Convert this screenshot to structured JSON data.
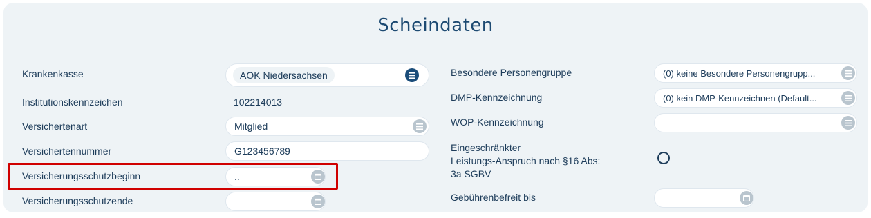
{
  "title": "Scheindaten",
  "left": {
    "krankenkasse": {
      "label": "Krankenkasse",
      "value": "AOK Niedersachsen",
      "icon": "list-icon"
    },
    "institutionskennzeichen": {
      "label": "Institutionskennzeichen",
      "value": "102214013"
    },
    "versichertenart": {
      "label": "Versichertenart",
      "value": "Mitglied",
      "icon": "list-icon"
    },
    "versichertennummer": {
      "label": "Versichertennummer",
      "value": "G123456789"
    },
    "schutzbeginn": {
      "label": "Versicherungsschutzbeginn",
      "value": "..",
      "icon": "calendar-icon"
    },
    "schutzende": {
      "label": "Versicherungsschutzende",
      "value": "",
      "icon": "calendar-icon"
    }
  },
  "right": {
    "personengruppe": {
      "label": "Besondere Personengruppe",
      "value": "(0) keine Besondere Personengrupp...",
      "icon": "list-icon"
    },
    "dmp": {
      "label": "DMP-Kennzeichnung",
      "value": "(0) kein DMP-Kennzeichnen (Default...",
      "icon": "list-icon"
    },
    "wop": {
      "label": "WOP-Kennzeichnung",
      "value": "",
      "icon": "list-icon"
    },
    "eingeschraenkt": {
      "label_line1": "Eingeschränkter",
      "label_line2": "Leistungs-Anspruch nach §16 Abs:",
      "label_line3": "3a SGBV"
    },
    "gebuehrenbefreit": {
      "label": "Gebührenbefreit bis",
      "value": "",
      "icon": "calendar-icon"
    }
  },
  "colors": {
    "accent": "#1b4d7a",
    "highlight": "#d00000",
    "panel": "#eef3f6"
  }
}
